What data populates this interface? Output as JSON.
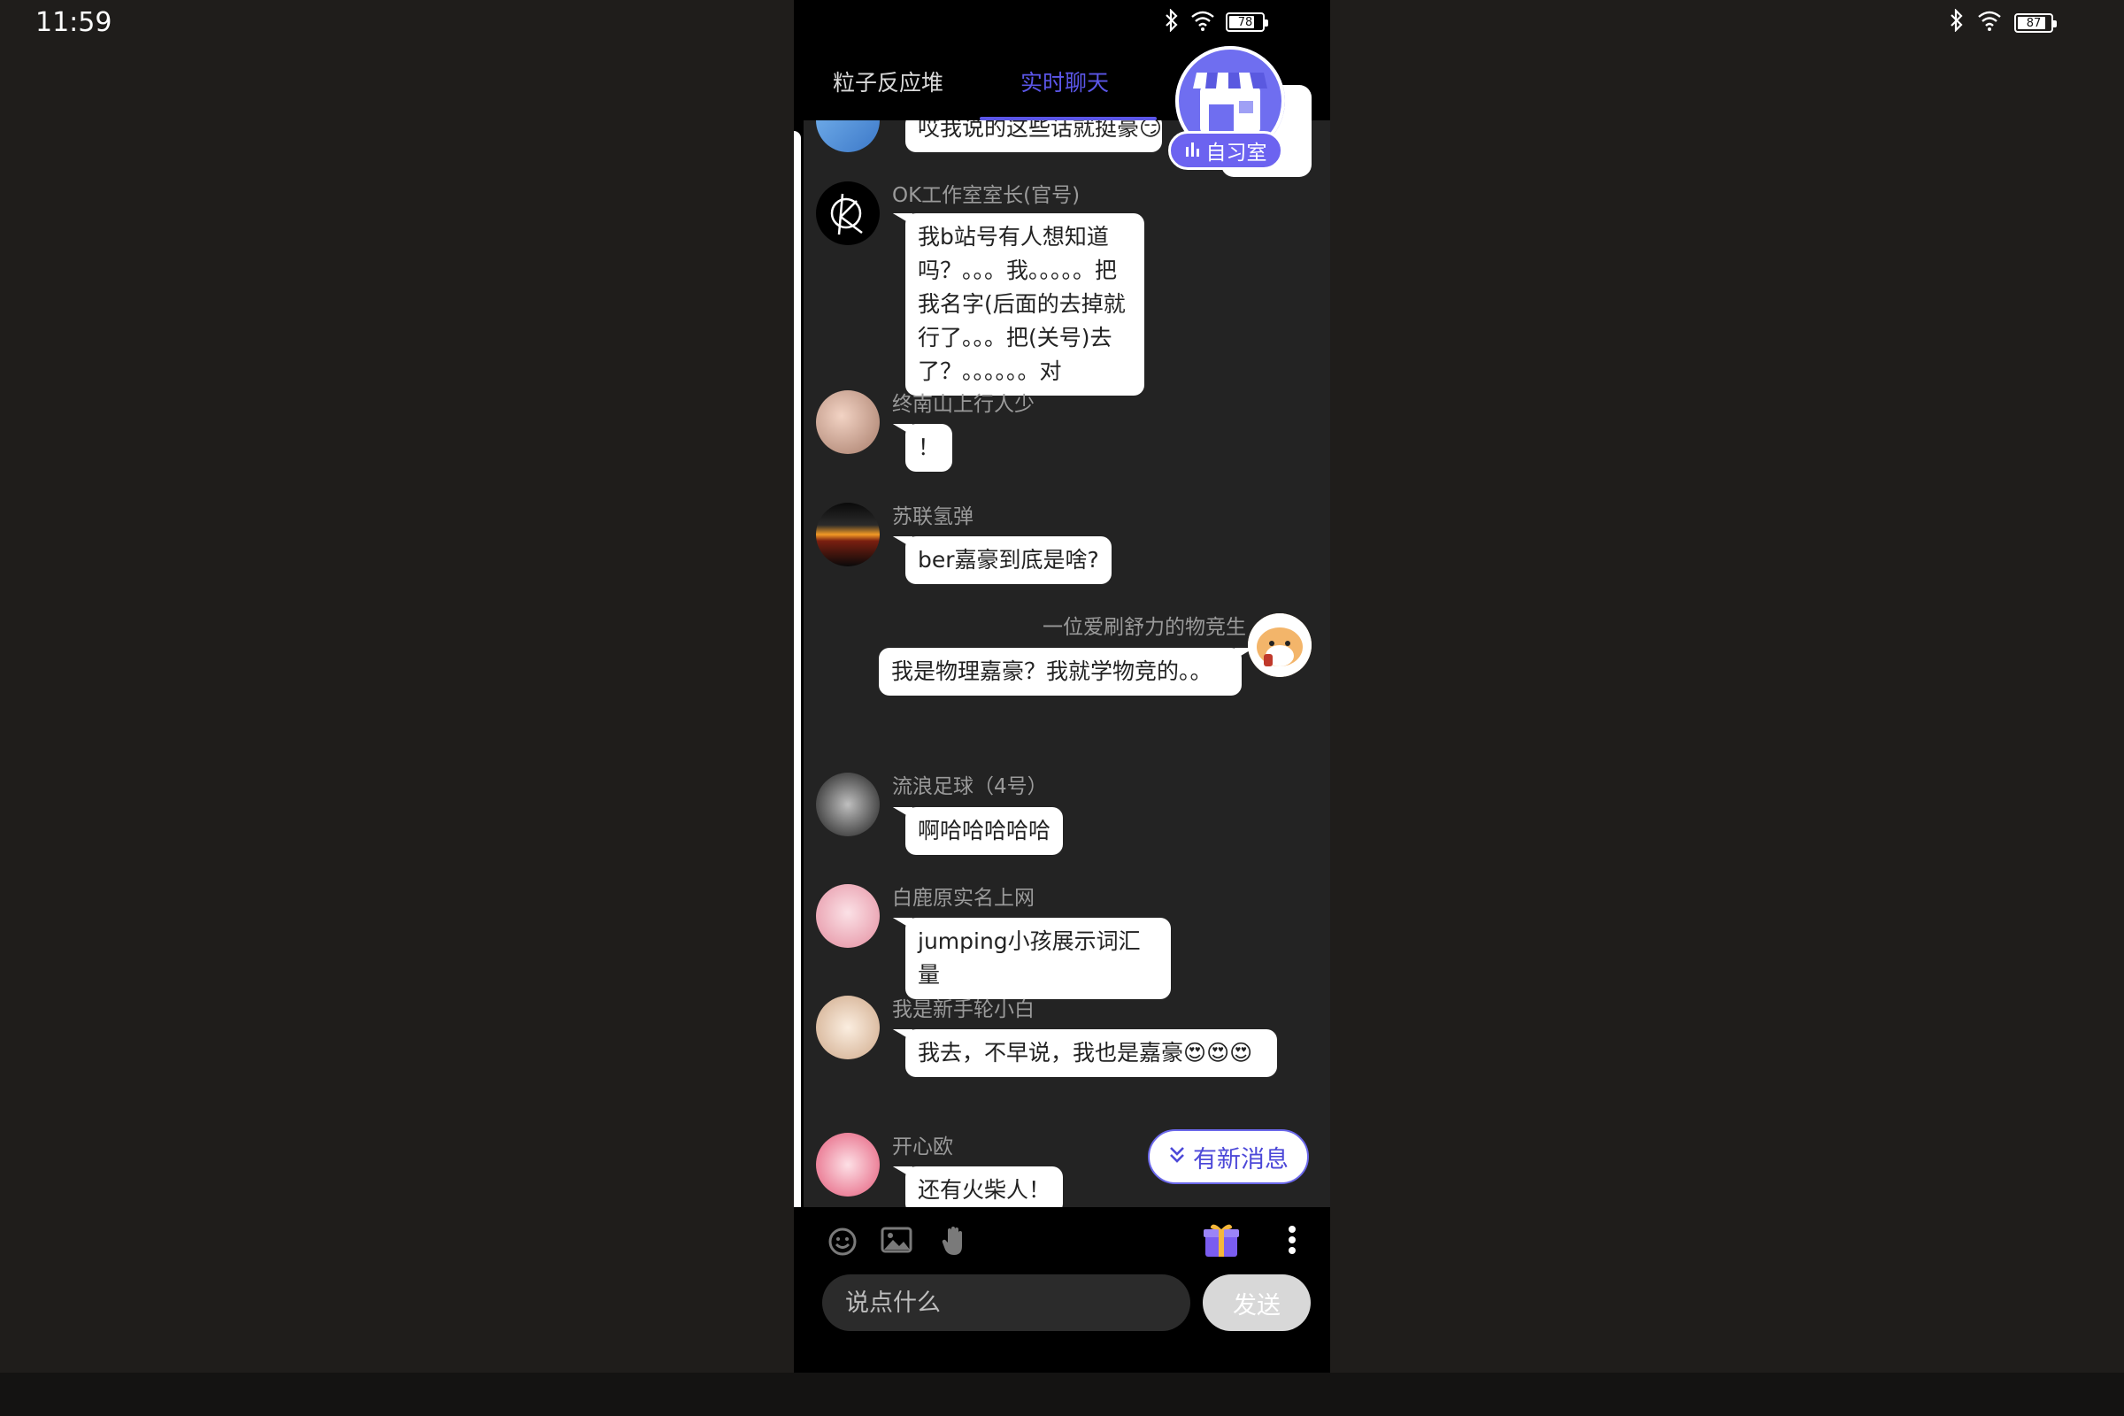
{
  "system": {
    "clock": "11:59",
    "outer_battery": "87",
    "outer_battery_level": 0.87,
    "phone_battery": "78",
    "phone_battery_level": 0.78
  },
  "tabs": [
    {
      "label": "粒子反应堆",
      "active": false
    },
    {
      "label": "实时聊天",
      "active": true
    }
  ],
  "study_room": {
    "label": "自习室"
  },
  "messages": [
    {
      "user": "",
      "text": "哎我说的这些话就挺豪😏",
      "side": "left",
      "partial": true
    },
    {
      "user": "OK工作室室长(官号)",
      "text": "我b站号有人想知道吗？。。。我。。。。。把我名字(后面的去掉就行了。。。把(关号)去了？。。。。。。对",
      "side": "left"
    },
    {
      "user": "终南山上行人少",
      "text": "！",
      "side": "left"
    },
    {
      "user": "苏联氢弹",
      "text": "ber嘉豪到底是啥?",
      "side": "left"
    },
    {
      "user": "一位爱刷舒力的物竞生",
      "text": "我是物理嘉豪？我就学物竞的。。",
      "side": "right"
    },
    {
      "user": "流浪足球（4号）",
      "text": "啊哈哈哈哈哈",
      "side": "left"
    },
    {
      "user": "白鹿原实名上网",
      "text": "jumping小孩展示词汇量",
      "side": "left"
    },
    {
      "user": "我是新手轮小白",
      "text": "我去，不早说，我也是嘉豪😍😍😍",
      "side": "left"
    },
    {
      "user": "开心欧",
      "text": "还有火柴人！",
      "side": "left"
    }
  ],
  "new_messages_button": "有新消息",
  "toolbar": {
    "icons": [
      "emoji-icon",
      "image-icon",
      "raise-hand-icon",
      "gift-icon",
      "more-icon"
    ]
  },
  "composer": {
    "placeholder": "说点什么",
    "send_label": "发送"
  },
  "colors": {
    "accent": "#5b56e8",
    "chat_bg": "#232323",
    "bubble_bg": "#ffffff"
  }
}
